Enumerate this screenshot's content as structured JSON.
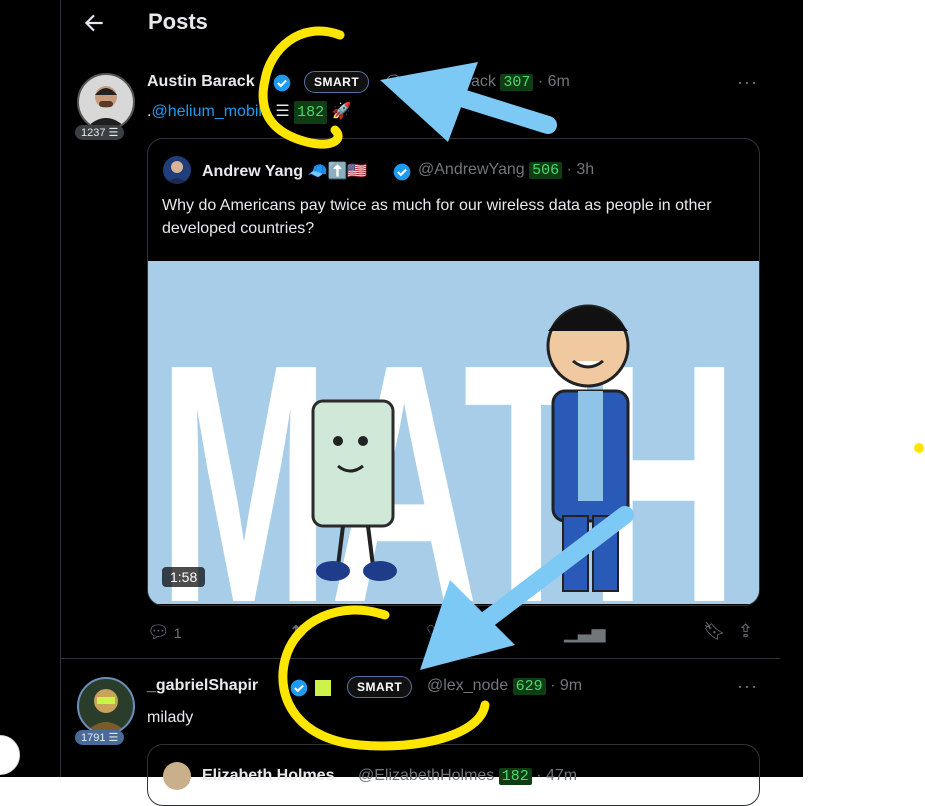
{
  "header": {
    "title": "Posts"
  },
  "post1": {
    "rep": "1237",
    "name": "Austin Barack",
    "handle_visible": "@",
    "handle_tail": "rack",
    "score": "307",
    "time": "· 6m",
    "smart": "SMART",
    "text_prefix": ".",
    "mention": "@helium_mobile",
    "mention_score": "182",
    "emoji": "🚀"
  },
  "quote": {
    "name": "Andrew Yang",
    "handle": "@AndrewYang",
    "score": "506",
    "time": "· 3h",
    "text": "Why do Americans pay twice as much for our wireless data as people in other developed countries?",
    "media_word": "MATH",
    "duration": "1:58"
  },
  "actions": {
    "reply_count": "1"
  },
  "post2": {
    "rep": "1791",
    "name": "_gabrielShapir",
    "smart": "SMART",
    "handle": "@lex_node",
    "score": "629",
    "time": "· 9m",
    "text": "milady"
  },
  "quote2": {
    "name": "Elizabeth Holmes",
    "handle": "@ElizabethHolmes",
    "score": "182",
    "time": "· 47m"
  },
  "colors": {
    "accent": "#1d9bf0",
    "score_bg": "#0f3d14",
    "score_fg": "#4ad86a",
    "annotation_yellow": "#ffe600",
    "annotation_blue": "#7cc9f5"
  }
}
